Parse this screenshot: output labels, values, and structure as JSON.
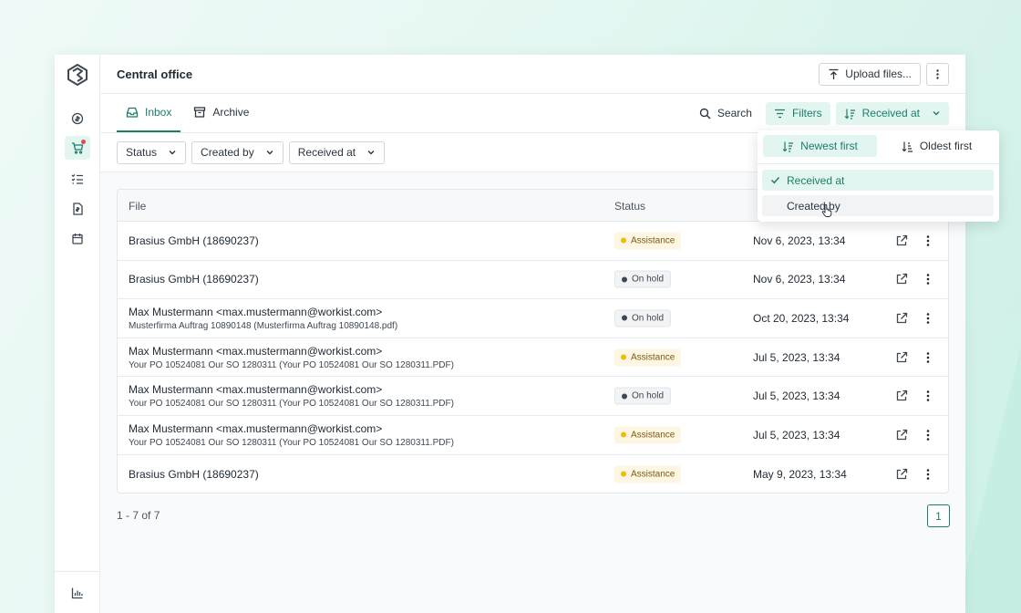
{
  "app": {
    "title": "Central office",
    "upload_label": "Upload files..."
  },
  "tabs": [
    {
      "label": "Inbox",
      "active": true
    },
    {
      "label": "Archive",
      "active": false
    }
  ],
  "toolbar": {
    "search_label": "Search",
    "filters_label": "Filters",
    "sort_label": "Received at"
  },
  "filters": [
    {
      "label": "Status"
    },
    {
      "label": "Created by"
    },
    {
      "label": "Received at"
    }
  ],
  "table": {
    "headers": {
      "file": "File",
      "status": "Status"
    },
    "rows": [
      {
        "file": "Brasius GmbH (18690237)",
        "sub": "",
        "status": "Assistance",
        "date": "Nov 6, 2023, 13:34"
      },
      {
        "file": "Brasius GmbH (18690237)",
        "sub": "",
        "status": "On hold",
        "date": "Nov 6, 2023, 13:34"
      },
      {
        "file": "Max Mustermann <max.mustermann@workist.com>",
        "sub": "Musterfirma Auftrag 10890148 (Musterfirma Auftrag 10890148.pdf)",
        "status": "On hold",
        "date": "Oct 20, 2023, 13:34"
      },
      {
        "file": "Max Mustermann <max.mustermann@workist.com>",
        "sub": "Your PO 10524081 Our SO 1280311 (Your PO 10524081 Our SO 1280311.PDF)",
        "status": "Assistance",
        "date": "Jul 5, 2023, 13:34"
      },
      {
        "file": "Max Mustermann <max.mustermann@workist.com>",
        "sub": "Your PO 10524081 Our SO 1280311 (Your PO 10524081 Our SO 1280311.PDF)",
        "status": "On hold",
        "date": "Jul 5, 2023, 13:34"
      },
      {
        "file": "Max Mustermann <max.mustermann@workist.com>",
        "sub": "Your PO 10524081 Our SO 1280311 (Your PO 10524081 Our SO 1280311.PDF)",
        "status": "Assistance",
        "date": "Jul 5, 2023, 13:34"
      },
      {
        "file": "Brasius GmbH (18690237)",
        "sub": "",
        "status": "Assistance",
        "date": "May 9, 2023, 13:34"
      }
    ]
  },
  "pagination": {
    "count_text": "1 - 7 of 7",
    "current_page": "1"
  },
  "sort_dropdown": {
    "order_options": [
      {
        "label": "Newest first",
        "active": true
      },
      {
        "label": "Oldest first",
        "active": false
      }
    ],
    "field_options": [
      {
        "label": "Received at",
        "selected": true
      },
      {
        "label": "Created by",
        "selected": false,
        "hovered": true
      }
    ]
  },
  "colors": {
    "accent": "#1c7d6b",
    "accent_bg": "#e3f5f0",
    "assistance_dot": "#f0b90b",
    "notification_dot": "#e5484d"
  },
  "icons": {
    "rail": [
      "chat-dollar-icon",
      "cart-icon",
      "checklist-icon",
      "invoice-icon",
      "calendar-icon"
    ],
    "rail_bottom": "bar-chart-icon"
  }
}
